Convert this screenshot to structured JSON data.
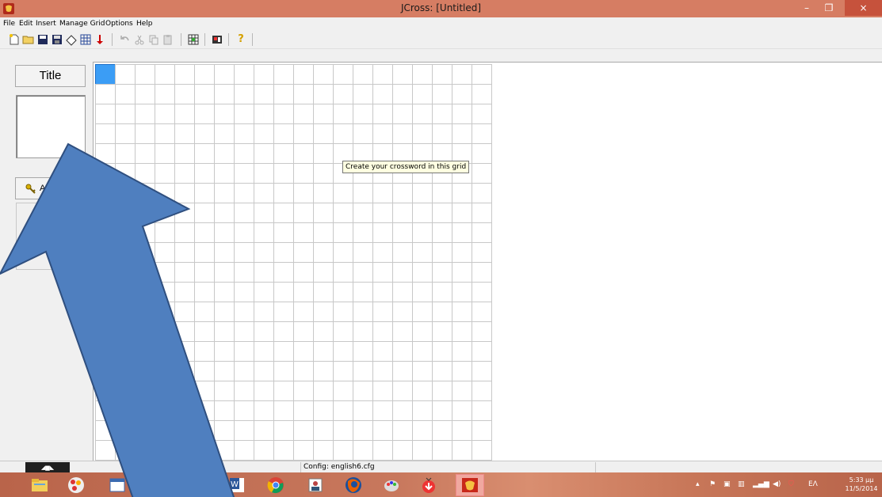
{
  "window": {
    "title": "JCross: [Untitled]",
    "controls": {
      "minimize": "–",
      "maximize": "❐",
      "close": "×"
    }
  },
  "menu": [
    "File",
    "Edit",
    "Insert",
    "Manage Grid",
    "Options",
    "Help"
  ],
  "toolbar": {
    "icons": [
      "new-file-icon",
      "open-folder-icon",
      "save-icon",
      "save-as-icon",
      "clear-icon",
      "export-web-icon",
      "add-icon",
      "undo-icon",
      "cut-icon",
      "copy-icon",
      "paste-icon",
      "grid-icon",
      "config-icon",
      "help-icon"
    ],
    "help_glyph": "?"
  },
  "left_panel": {
    "title_button": "Title",
    "answer_button": "Add clue"
  },
  "grid": {
    "columns": 20,
    "rows": 20,
    "selected_cell": [
      0,
      0
    ],
    "tooltip": "Create your crossword in this grid"
  },
  "status": {
    "config": "Config: english6.cfg"
  },
  "taskbar": {
    "tray_language": "ΕΛ",
    "time": "5:33 μμ",
    "date": "11/5/2014",
    "apps": [
      "file-explorer-icon",
      "paint-icon",
      "window-icon",
      "blank",
      "blank",
      "word-icon",
      "chrome-icon",
      "user-icon",
      "firefox-icon",
      "art-icon",
      "downloader-icon",
      "hotpotatoes-icon"
    ]
  },
  "colors": {
    "titlebar": "#d67d63",
    "selected_cell": "#3b9df5",
    "arrow": "#4f7fbf",
    "arrow_stroke": "#2f4f7f"
  }
}
